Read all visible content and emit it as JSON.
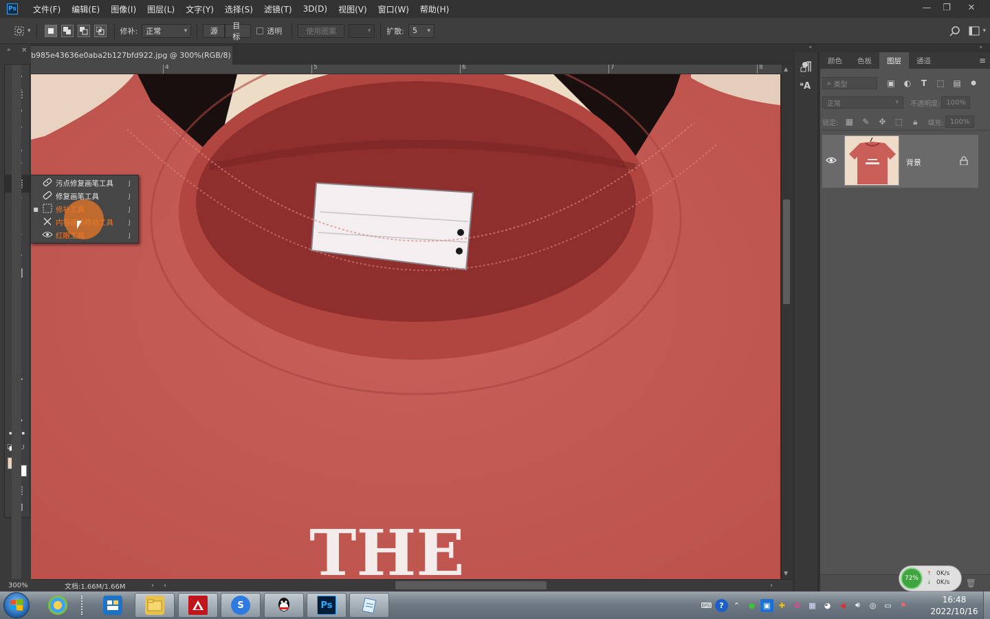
{
  "app": {
    "logo": "Ps"
  },
  "menu": [
    "文件(F)",
    "编辑(E)",
    "图像(I)",
    "图层(L)",
    "文字(Y)",
    "选择(S)",
    "滤镜(T)",
    "3D(D)",
    "视图(V)",
    "窗口(W)",
    "帮助(H)"
  ],
  "window_controls": {
    "minimize": "—",
    "restore": "❐",
    "close": "✕"
  },
  "options": {
    "patch_label": "修补:",
    "patch_value": "正常",
    "source_label": "源",
    "target_label": "目标",
    "transparent_label": "透明",
    "use_pattern_label": "使用图案",
    "diffusion_label": "扩散:",
    "diffusion_value": "5"
  },
  "document": {
    "tab_title": "b985e43636e0aba2b127bfd922.jpg @ 300%(RGB/8) *",
    "close_glyph": "×",
    "zoom": "300%",
    "doc_info": "文档:1.66M/1.66M",
    "ruler_marks": [
      "4",
      "5",
      "6",
      "7",
      "8"
    ],
    "print_text": "THE"
  },
  "tool_flyout": {
    "items": [
      {
        "label": "污点修复画笔工具",
        "shortcut": "J",
        "icon": "spot-healing-brush-icon",
        "selected": false
      },
      {
        "label": "修复画笔工具",
        "shortcut": "J",
        "icon": "healing-brush-icon",
        "selected": false
      },
      {
        "label": "修补工具",
        "shortcut": "J",
        "icon": "patch-icon",
        "selected": true
      },
      {
        "label": "内容感知移动工具",
        "shortcut": "J",
        "icon": "content-aware-move-icon",
        "selected": false
      },
      {
        "label": "红眼工具",
        "shortcut": "J",
        "icon": "red-eye-icon",
        "selected": false
      }
    ]
  },
  "panels": {
    "tabs": [
      "颜色",
      "色板",
      "图层",
      "通道"
    ],
    "active_tab": "图层",
    "filter_placeholder": "类型",
    "blend_mode": "正常",
    "opacity_label": "不透明度:",
    "opacity_value": "100%",
    "lock_label": "锁定:",
    "fill_label": "填充:",
    "fill_value": "100%",
    "layers": [
      {
        "name": "背景",
        "visible": true,
        "locked": true
      }
    ]
  },
  "net_monitor": {
    "percent": "72%",
    "up": "0K/s",
    "down": "0K/s"
  },
  "taskbar": {
    "apps": [
      "windows-logo",
      "photos",
      "explorer",
      "files",
      "autocad",
      "sogou",
      "qq",
      "photoshop",
      "notepad"
    ],
    "time": "16:48",
    "date": "2022/10/16"
  },
  "colors": {
    "accent": "#31a8ff",
    "shirt": "#c85e57",
    "background_tan": "#eedcc8"
  }
}
